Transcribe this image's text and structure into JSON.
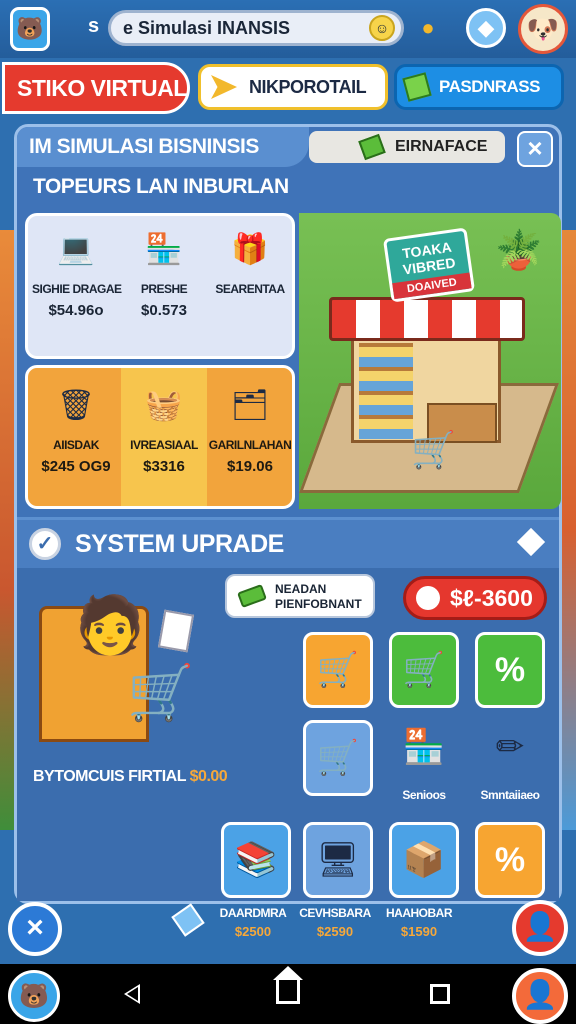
{
  "topbar": {
    "letter": "s",
    "search_text": "e Simulasi INANSIS",
    "smile_glyph": "☺",
    "coin_glyph": "●",
    "shield_glyph": "◆",
    "avatar_glyph": "🐶",
    "app_glyph": "🐻"
  },
  "tabs": {
    "main": "STIKO VIRTUAL",
    "second": "NIKPOROTAIL",
    "third": "PASDNRASS"
  },
  "panel": {
    "title": "IM SIMULASI BISNINSIS",
    "badge": "EIRNAFACE",
    "close": "×",
    "subtitle": "TOPEURS LAN INBURLAN"
  },
  "items_top": [
    {
      "name": "SIGHIE DRAGAE",
      "price": "$54.96o",
      "icon": "💻",
      "color": "#4c4f5a"
    },
    {
      "name": "PRESHE",
      "price": "$0.573",
      "icon": "🏪",
      "color": "#d8822c"
    },
    {
      "name": "SEARENTAA",
      "price": "",
      "icon": "🎁",
      "color": "#5a76c8"
    }
  ],
  "items_bottom": [
    {
      "name": "AIISDAK",
      "price": "$245 OG9",
      "icon": "🗑",
      "color": "#3b62b0"
    },
    {
      "name": "IVREASIAAL",
      "price": "$3316",
      "icon": "🧺",
      "color": "#e8a02c"
    },
    {
      "name": "GARILNLAHAN",
      "price": "$19.06",
      "icon": "🗂",
      "color": "#7a7f8c"
    }
  ],
  "scene": {
    "sign_title": "TOAKA VIBRED",
    "sign_sub": "DOAIVED",
    "plant_icon": "🪴",
    "cart_icon": "🛒"
  },
  "system": {
    "title": "SYSTEM UPRADE",
    "check": "✓",
    "pill_line1": "NEADAN",
    "pill_line2": "PIENFOBNANT",
    "price": "$ℓ-3600",
    "caption": "BYTOMCUIS FIRTIAL",
    "caption_money": "$0.00",
    "person_icon": "🧑",
    "cart_icon": "🛒"
  },
  "upgrades": [
    {
      "id": "cart",
      "icon": "🛒",
      "bg": "#f7a531",
      "label": ""
    },
    {
      "id": "cart-green",
      "icon": "🛒",
      "bg": "#4cbc3c",
      "label": ""
    },
    {
      "id": "percent",
      "icon": "%",
      "bg": "#4cbc3c",
      "label": ""
    },
    {
      "id": "cart-blue",
      "icon": "🛒",
      "bg": "#6ea3df",
      "label": ""
    },
    {
      "id": "store",
      "icon": "🏪",
      "bg": "transparent",
      "label": "Senioos"
    },
    {
      "id": "pencil",
      "icon": "✏",
      "bg": "transparent",
      "label": "Smntaiiaeo"
    },
    {
      "id": "book",
      "icon": "📚",
      "bg": "#4ba2e6",
      "label": ""
    },
    {
      "id": "pos",
      "icon": "🖥",
      "bg": "#6ea3df",
      "label": ""
    },
    {
      "id": "box",
      "icon": "📦",
      "bg": "#4ba2e6",
      "label": ""
    },
    {
      "id": "percent-orange",
      "icon": "%",
      "bg": "#f7a531",
      "label": ""
    }
  ],
  "bottom": {
    "close": "×",
    "items": [
      {
        "name": "DAARDMRA",
        "price": "$2500"
      },
      {
        "name": "CEVHSBARA",
        "price": "$2590"
      },
      {
        "name": "HAAHOBAR",
        "price": "$1590"
      }
    ],
    "user_glyph": "👤"
  },
  "nav": {
    "app_glyph": "🐻",
    "profile_glyph": "👤"
  },
  "colors": {
    "accent_red": "#e53a2e",
    "accent_blue": "#1d8ee4",
    "panel_blue": "#3f73b8",
    "accent_orange": "#f2a43c",
    "green": "#4cbc3c"
  }
}
